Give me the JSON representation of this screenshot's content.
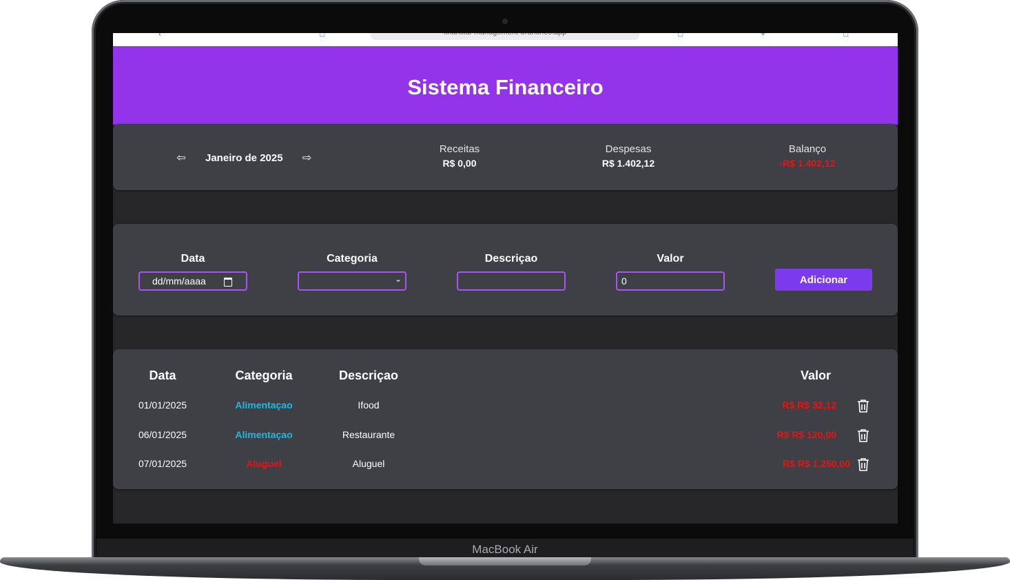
{
  "device": {
    "label": "MacBook Air"
  },
  "browser": {
    "url": "financial-management-branches.app"
  },
  "app": {
    "title": "Sistema Financeiro",
    "month_label": "Janeiro de 2025",
    "summary": {
      "receitas_label": "Receitas",
      "receitas_value": "R$ 0,00",
      "despesas_label": "Despesas",
      "despesas_value": "R$ 1.402,12",
      "balanco_label": "Balanço",
      "balanco_value": "-R$ 1.402,12"
    },
    "form": {
      "data_label": "Data",
      "data_placeholder": "dd/mm/aaaa",
      "categoria_label": "Categoria",
      "categoria_value": "",
      "descricao_label": "Descriçao",
      "descricao_value": "",
      "valor_label": "Valor",
      "valor_value": "0",
      "add_label": "Adicionar"
    },
    "table": {
      "headers": {
        "data": "Data",
        "categoria": "Categoria",
        "descricao": "Descriçao",
        "valor": "Valor"
      },
      "rows": [
        {
          "data": "01/01/2025",
          "categoria": "Alimentaçao",
          "descricao": "Ifood",
          "valor": "R$ R$ 32,12"
        },
        {
          "data": "06/01/2025",
          "categoria": "Alimentaçao",
          "descricao": "Restaurante",
          "valor": "R$ R$ 120,00"
        },
        {
          "data": "07/01/2025",
          "categoria": "Aluguel",
          "descricao": "Aluguel",
          "valor": "R$ R$ 1.250,00"
        }
      ]
    },
    "colors": {
      "header_bg": "#9333ea",
      "button_bg": "#7c3aed",
      "negative": "#ef1111",
      "category_food": "#22b8e0",
      "category_rent": "#ef1111"
    }
  }
}
